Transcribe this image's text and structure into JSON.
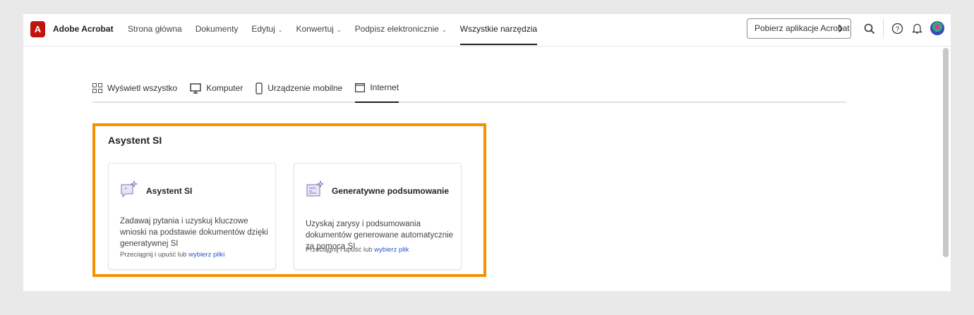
{
  "header": {
    "logo_glyph": "A",
    "brand": "Adobe Acrobat",
    "nav": [
      {
        "label": "Strona główna",
        "dropdown": false
      },
      {
        "label": "Dokumenty",
        "dropdown": false
      },
      {
        "label": "Edytuj",
        "dropdown": true
      },
      {
        "label": "Konwertuj",
        "dropdown": true
      },
      {
        "label": "Podpisz elektronicznie",
        "dropdown": true
      },
      {
        "label": "Wszystkie narzędzia",
        "dropdown": false,
        "active": true
      }
    ],
    "get_app_label": "Pobierz aplikacje Acrobat"
  },
  "tabs": [
    {
      "label": "Wyświetl wszystko",
      "icon": "grid-icon"
    },
    {
      "label": "Komputer",
      "icon": "monitor-icon"
    },
    {
      "label": "Urządzenie mobilne",
      "icon": "phone-icon"
    },
    {
      "label": "Internet",
      "icon": "browser-icon",
      "active": true
    }
  ],
  "section": {
    "title": "Asystent SI",
    "cards": [
      {
        "title": "Asystent SI",
        "desc": "Zadawaj pytania i uzyskuj kluczowe wnioski na podstawie dokumentów dzięki generatywnej SI",
        "hint": "Przeciągnij i upuść lub ",
        "link": "wybierz pliki"
      },
      {
        "title": "Generatywne podsumowanie",
        "desc": "Uzyskaj zarysy i podsumowania dokumentów generowane automatycznie za pomocą SI",
        "hint": "Przeciągnij i upuść lub ",
        "link": "wybierz plik"
      }
    ]
  },
  "colors": {
    "accent": "#f39200",
    "brand": "#c0140c",
    "link": "#2c56c6"
  }
}
